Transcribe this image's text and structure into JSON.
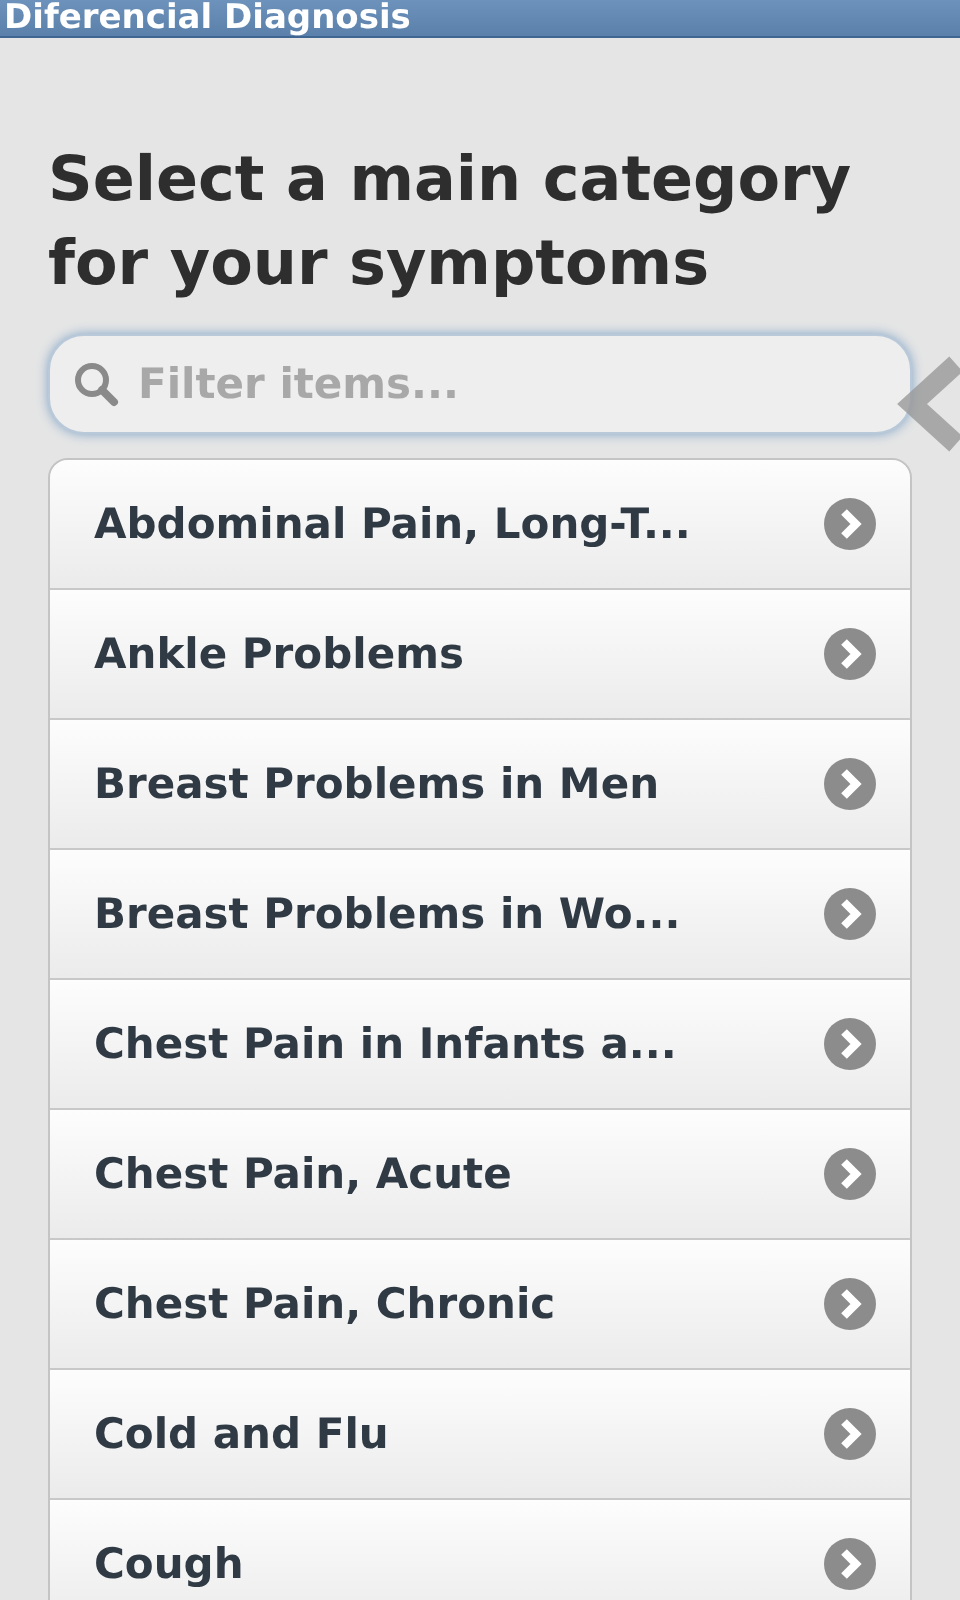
{
  "window": {
    "title": "Diferencial Diagnosis"
  },
  "heading": "Select a main category for your symptoms",
  "search": {
    "placeholder": "Filter items..."
  },
  "items": [
    {
      "label": "Abdominal Pain, Long-T..."
    },
    {
      "label": "Ankle Problems"
    },
    {
      "label": "Breast Problems in Men"
    },
    {
      "label": "Breast Problems in Wo..."
    },
    {
      "label": "Chest Pain in Infants a..."
    },
    {
      "label": "Chest Pain, Acute"
    },
    {
      "label": "Chest Pain, Chronic"
    },
    {
      "label": "Cold and Flu"
    },
    {
      "label": "Cough"
    }
  ]
}
